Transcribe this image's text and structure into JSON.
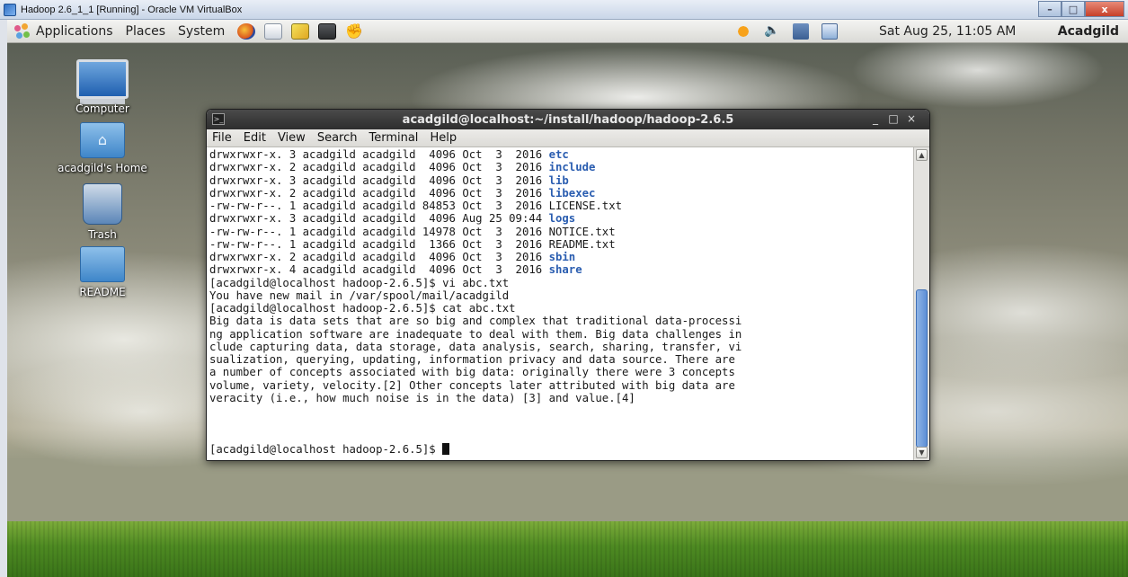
{
  "host": {
    "title": "Hadoop 2.6_1_1 [Running] - Oracle VM VirtualBox",
    "controls": {
      "minimize": "–",
      "maximize": "□",
      "close": "x"
    }
  },
  "panel": {
    "menus": [
      "Applications",
      "Places",
      "System"
    ],
    "launchers": [
      "firefox-icon",
      "mail-icon",
      "text-editor-icon",
      "terminal-icon",
      "screenshot-icon"
    ],
    "tray": [
      "update-icon",
      "volume-icon",
      "network-icon",
      "battery-icon"
    ],
    "clock": "Sat Aug 25, 11:05 AM",
    "user": "Acadgild"
  },
  "desktop": {
    "icons": [
      {
        "label": "Computer"
      },
      {
        "label": "acadgild's Home"
      },
      {
        "label": "Trash"
      },
      {
        "label": "README"
      }
    ]
  },
  "terminal": {
    "title": "acadgild@localhost:~/install/hadoop/hadoop-2.6.5",
    "window_controls": {
      "minimize": "_",
      "maximize": "□",
      "close": "×"
    },
    "menu": [
      "File",
      "Edit",
      "View",
      "Search",
      "Terminal",
      "Help"
    ],
    "listing": [
      {
        "perms": "drwxrwxr-x. 3 acadgild acadgild  4096 Oct  3  2016 ",
        "name": "etc",
        "dir": true
      },
      {
        "perms": "drwxrwxr-x. 2 acadgild acadgild  4096 Oct  3  2016 ",
        "name": "include",
        "dir": true
      },
      {
        "perms": "drwxrwxr-x. 3 acadgild acadgild  4096 Oct  3  2016 ",
        "name": "lib",
        "dir": true
      },
      {
        "perms": "drwxrwxr-x. 2 acadgild acadgild  4096 Oct  3  2016 ",
        "name": "libexec",
        "dir": true
      },
      {
        "perms": "-rw-rw-r--. 1 acadgild acadgild 84853 Oct  3  2016 ",
        "name": "LICENSE.txt",
        "dir": false
      },
      {
        "perms": "drwxrwxr-x. 3 acadgild acadgild  4096 Aug 25 09:44 ",
        "name": "logs",
        "dir": true
      },
      {
        "perms": "-rw-rw-r--. 1 acadgild acadgild 14978 Oct  3  2016 ",
        "name": "NOTICE.txt",
        "dir": false
      },
      {
        "perms": "-rw-rw-r--. 1 acadgild acadgild  1366 Oct  3  2016 ",
        "name": "README.txt",
        "dir": false
      },
      {
        "perms": "drwxrwxr-x. 2 acadgild acadgild  4096 Oct  3  2016 ",
        "name": "sbin",
        "dir": true
      },
      {
        "perms": "drwxrwxr-x. 4 acadgild acadgild  4096 Oct  3  2016 ",
        "name": "share",
        "dir": true
      }
    ],
    "output_lines": [
      "[acadgild@localhost hadoop-2.6.5]$ vi abc.txt",
      "You have new mail in /var/spool/mail/acadgild",
      "[acadgild@localhost hadoop-2.6.5]$ cat abc.txt",
      "Big data is data sets that are so big and complex that traditional data-processi",
      "ng application software are inadequate to deal with them. Big data challenges in",
      "clude capturing data, data storage, data analysis, search, sharing, transfer, vi",
      "sualization, querying, updating, information privacy and data source. There are",
      "a number of concepts associated with big data: originally there were 3 concepts",
      "volume, variety, velocity.[2] Other concepts later attributed with big data are",
      "veracity (i.e., how much noise is in the data) [3] and value.[4]",
      "",
      "",
      ""
    ],
    "prompt": "[acadgild@localhost hadoop-2.6.5]$ "
  }
}
